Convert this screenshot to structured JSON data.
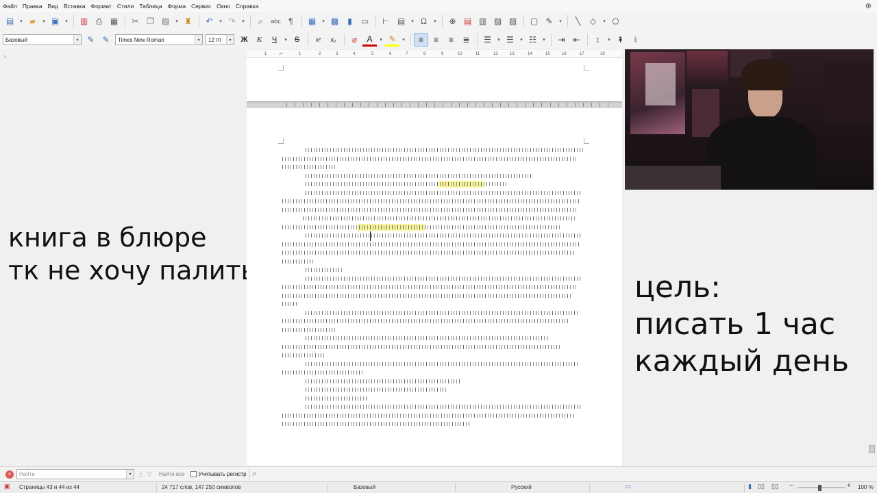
{
  "menu": {
    "items": [
      "Файл",
      "Правка",
      "Вид",
      "Вставка",
      "Формат",
      "Стили",
      "Таблица",
      "Форма",
      "Сервис",
      "Окно",
      "Справка"
    ]
  },
  "toolbar": {
    "paragraph_style": "Базовый",
    "font_name": "Times New Roman",
    "font_size": "12 пт",
    "bold": "Ж",
    "italic": "К",
    "underline": "Ч",
    "strike": "S",
    "superscript": "x²",
    "subscript": "x₂"
  },
  "ruler": {
    "ticks": [
      "1",
      "1",
      "2",
      "3",
      "4",
      "5",
      "6",
      "7",
      "8",
      "9",
      "10",
      "11",
      "12",
      "13",
      "14",
      "15",
      "16",
      "17",
      "18"
    ]
  },
  "overlay": {
    "left_line1": "книга в блюре",
    "left_line2": "тк не хочу палить",
    "right_line1": "цель:",
    "right_line2": "писать 1 час",
    "right_line3": "каждый день"
  },
  "findbar": {
    "placeholder": "Найти",
    "find_all": "Найти все",
    "match_case": "Учитывать регистр"
  },
  "status": {
    "pages": "Страницы 43 и 44 из 44",
    "words": "24 717 слов, 147 250 символов",
    "style": "Базовый",
    "language": "Русский",
    "zoom": "100 %"
  },
  "colors": {
    "highlight": "#f4f07a",
    "accent": "#3b6fb6",
    "find_close": "#e05a5a"
  }
}
